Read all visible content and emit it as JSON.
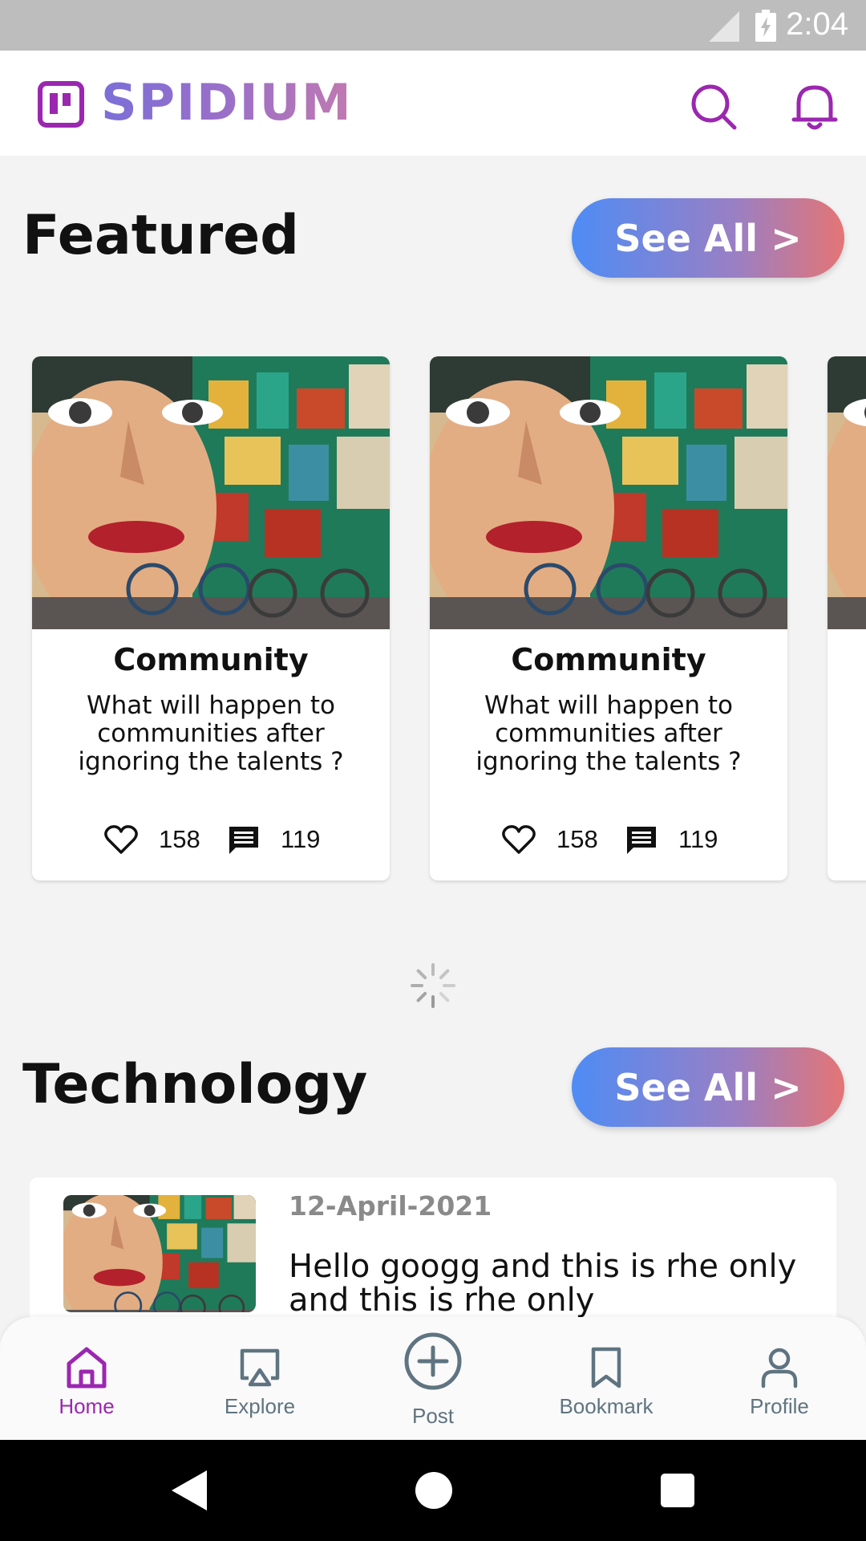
{
  "status_bar": {
    "time": "2:04"
  },
  "app_bar": {
    "title": "SPIDIUM"
  },
  "featured": {
    "title": "Featured",
    "see_all": "See All >",
    "cards": [
      {
        "category": "Community",
        "text": "What will happen to\n communities after\nignoring  the talents ?",
        "likes": "158",
        "comments": "119"
      },
      {
        "category": "Community",
        "text": "What will happen to\n communities after\nignoring  the talents ?",
        "likes": "158",
        "comments": "119"
      }
    ]
  },
  "technology": {
    "title": "Technology",
    "see_all": "See All >",
    "items": [
      {
        "date": "12-April-2021",
        "title": "Hello googg and this is rhe only and this is rhe only"
      }
    ]
  },
  "bottom_nav": {
    "items": [
      {
        "label": "Home",
        "icon": "home-icon",
        "active": true
      },
      {
        "label": "Explore",
        "icon": "cast-icon",
        "active": false
      },
      {
        "label": "Post",
        "icon": "plus-circle-icon",
        "active": false
      },
      {
        "label": "Bookmark",
        "icon": "bookmark-icon",
        "active": false
      },
      {
        "label": "Profile",
        "icon": "user-icon",
        "active": false
      }
    ]
  },
  "colors": {
    "accent": "#9b27b0",
    "nav_inactive": "#5f7480",
    "gradient_start": "#4e8cf5",
    "gradient_end": "#e47575"
  }
}
